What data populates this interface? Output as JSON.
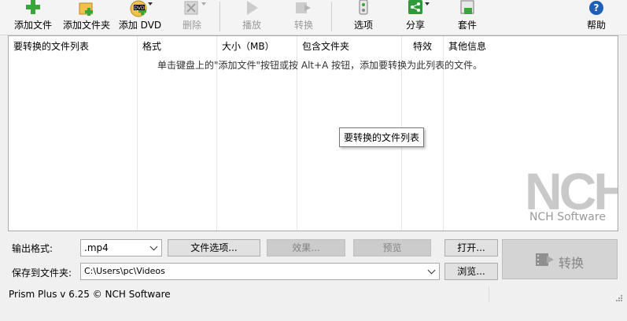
{
  "toolbar": {
    "add_file": "添加文件",
    "add_folder": "添加文件夹",
    "add_dvd": "添加 DVD",
    "dvd_badge": "DVD",
    "delete": "删除",
    "play": "播放",
    "convert": "转换",
    "options": "选项",
    "share": "分享",
    "suite": "套件",
    "help": "帮助"
  },
  "list": {
    "columns": [
      "要转换的文件列表",
      "格式",
      "大小（MB）",
      "包含文件夹",
      "特效",
      "其他信息"
    ],
    "hint": "单击键盘上的\"添加文件\"按钮或按 Alt+A 按钮，添加要转换为此列表的文件。",
    "tooltip": "要转换的文件列表",
    "logo_text": "NCH Software"
  },
  "bottom": {
    "output_format_label": "输出格式:",
    "output_format_value": ".mp4",
    "file_options": "文件选项...",
    "effects": "效果...",
    "preview": "预览",
    "open": "打开...",
    "save_label": "保存到文件夹:",
    "save_path": "C:\\Users\\pc\\Videos",
    "browse": "浏览...",
    "convert": "转换"
  },
  "status": {
    "text": "Prism Plus v 6.25 © NCH Software"
  },
  "colors": {
    "green": "#3aa63a",
    "gray_disabled": "#9a9a9a",
    "help_blue": "#1f5fb4"
  }
}
